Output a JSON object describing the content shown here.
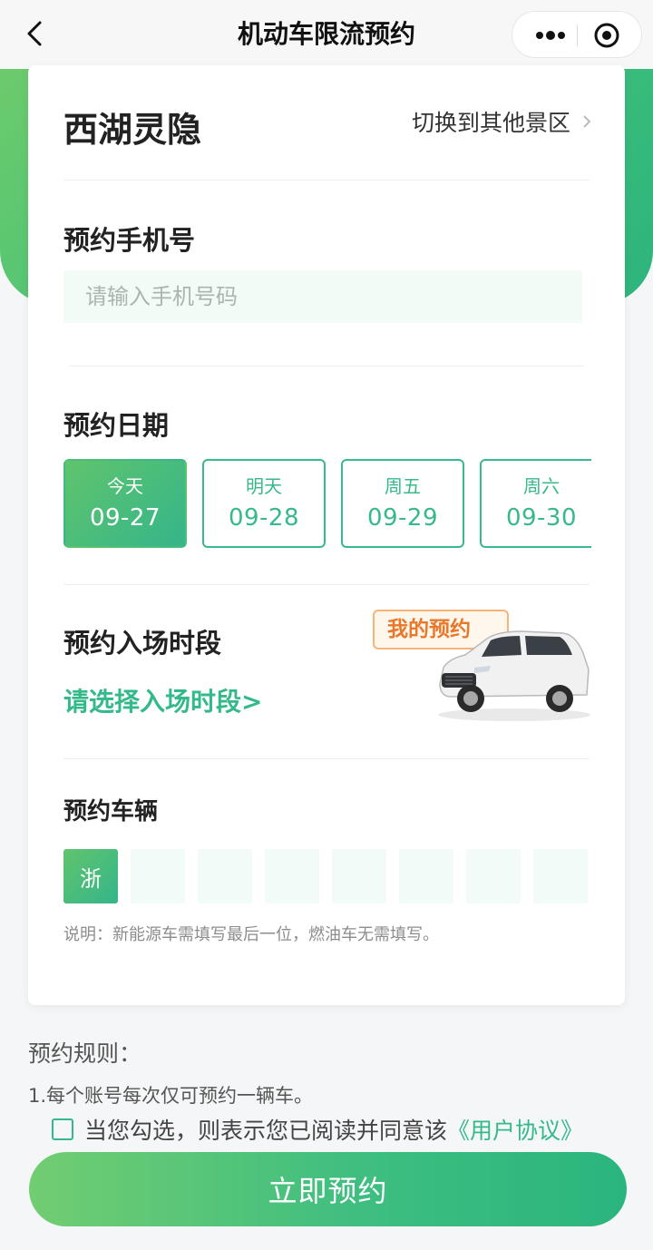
{
  "nav": {
    "title": "机动车限流预约"
  },
  "scenic": {
    "name": "西湖灵隐",
    "switch_label": "切换到其他景区"
  },
  "phone": {
    "label": "预约手机号",
    "placeholder": "请输入手机号码",
    "value": ""
  },
  "date": {
    "label": "预约日期",
    "options": [
      {
        "weekday": "今天",
        "date": "09-27",
        "selected": true
      },
      {
        "weekday": "明天",
        "date": "09-28",
        "selected": false
      },
      {
        "weekday": "周五",
        "date": "09-29",
        "selected": false
      },
      {
        "weekday": "周六",
        "date": "09-30",
        "selected": false
      }
    ]
  },
  "time_slot": {
    "label": "预约入场时段",
    "pick_label": "请选择入场时段>",
    "my_reservations_label": "我的预约"
  },
  "vehicle": {
    "label": "预约车辆",
    "province": "浙",
    "plate_cells": [
      "",
      "",
      "",
      "",
      "",
      "",
      ""
    ],
    "note": "说明：新能源车需填写最后一位，燃油车无需填写。"
  },
  "rules": {
    "title": "预约规则：",
    "items": [
      "1.每个账号每次仅可预约一辆车。"
    ]
  },
  "agreement": {
    "text": "当您勾选，则表示您已阅读并同意该",
    "link": "《用户协议》",
    "checked": false
  },
  "submit_label": "立即预约",
  "colors": {
    "accent": "#33b98a",
    "badge_orange": "#e8792c"
  },
  "icons": [
    "back-arrow-icon",
    "more-dots-icon",
    "target-icon",
    "chevron-right-icon",
    "car-image"
  ]
}
